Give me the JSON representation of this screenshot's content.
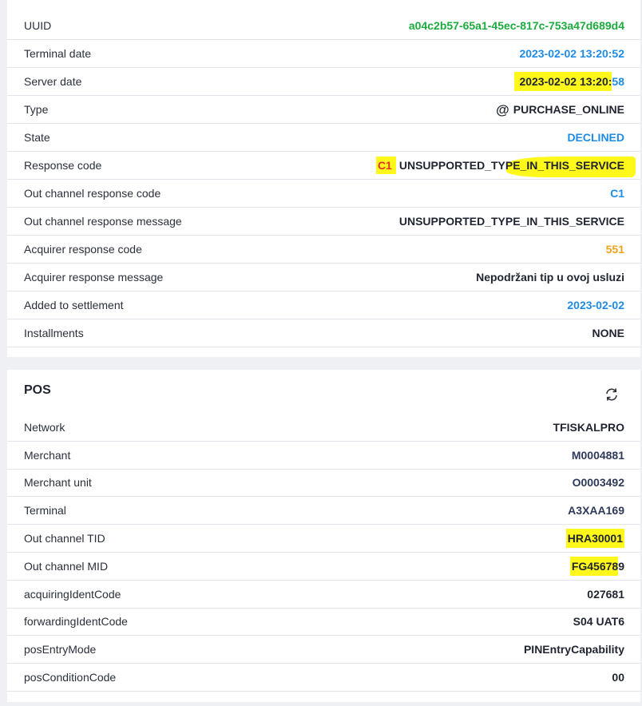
{
  "transaction": {
    "rows": [
      {
        "label": "UUID",
        "value": "a04c2b57-65a1-45ec-817c-753a47d689d4"
      },
      {
        "label": "Terminal date",
        "value": "2023-02-02 13:20:52"
      },
      {
        "label": "Server date",
        "value_hl": "2023-02-02 13:20:",
        "value_rest": "58"
      },
      {
        "label": "Type",
        "icon": "at-icon",
        "value": "PURCHASE_ONLINE"
      },
      {
        "label": "State",
        "value": "DECLINED"
      },
      {
        "label": "Response code",
        "code": "C1",
        "value": "UNSUPPORTED_TYPE_IN_THIS_SERVICE"
      },
      {
        "label": "Out channel response code",
        "value": "C1"
      },
      {
        "label": "Out channel response message",
        "value": "UNSUPPORTED_TYPE_IN_THIS_SERVICE"
      },
      {
        "label": "Acquirer response code",
        "value": "551"
      },
      {
        "label": "Acquirer response message",
        "value": "Nepodržani tip u ovoj usluzi"
      },
      {
        "label": "Added to settlement",
        "value": "2023-02-02"
      },
      {
        "label": "Installments",
        "value": "NONE"
      }
    ]
  },
  "pos": {
    "title": "POS",
    "refresh_icon": "refresh-icon",
    "rows": [
      {
        "label": "Network",
        "value": "TFISKALPRO"
      },
      {
        "label": "Merchant",
        "value": "M0004881"
      },
      {
        "label": "Merchant unit",
        "value": "O0003492"
      },
      {
        "label": "Terminal",
        "value": "A3XAA169"
      },
      {
        "label": "Out channel TID",
        "value": "HRA30001"
      },
      {
        "label": "Out channel MID",
        "value_hl": "FG45678",
        "value_rest": "9"
      },
      {
        "label": "acquiringIdentCode",
        "value": "027681"
      },
      {
        "label": "forwardingIdentCode",
        "value": "S04 UAT6"
      },
      {
        "label": "posEntryMode",
        "value": "PINEntryCapability"
      },
      {
        "label": "posConditionCode",
        "value": "00"
      }
    ]
  },
  "colors": {
    "uuid": "#1cab3e",
    "date": "#1e8be6",
    "acquirer_code": "#f0a21a",
    "merchant_ids": "#2f3a5a",
    "response_code": "#e0342c",
    "highlighter": "#fff81a"
  }
}
